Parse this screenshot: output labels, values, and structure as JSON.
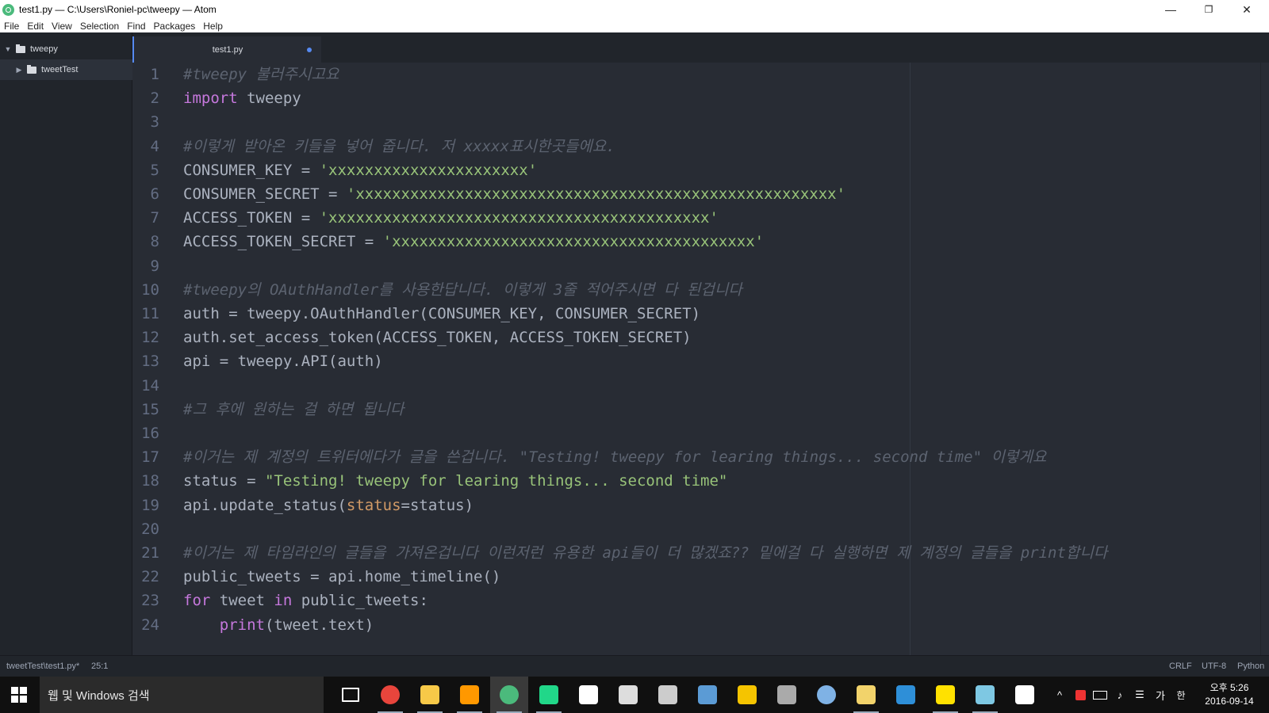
{
  "window": {
    "title": "test1.py — C:\\Users\\Roniel-pc\\tweepy — Atom",
    "controls": {
      "minimize": "—",
      "maximize": "❐",
      "close": "✕"
    }
  },
  "menu": [
    "File",
    "Edit",
    "View",
    "Selection",
    "Find",
    "Packages",
    "Help"
  ],
  "tree": {
    "root": "tweepy",
    "child": "tweetTest"
  },
  "tab": {
    "label": "test1.py"
  },
  "editor": {
    "lines": [
      {
        "n": "1",
        "parts": [
          {
            "c": "cm",
            "t": "#tweepy 불러주시고요"
          }
        ]
      },
      {
        "n": "2",
        "parts": [
          {
            "c": "kw",
            "t": "import"
          },
          {
            "c": "",
            "t": " tweepy"
          }
        ]
      },
      {
        "n": "3",
        "parts": []
      },
      {
        "n": "4",
        "parts": [
          {
            "c": "cm",
            "t": "#이렇게 받아온 키들을 넣어 줍니다. 저 xxxxx표시한곳들에요."
          }
        ]
      },
      {
        "n": "5",
        "parts": [
          {
            "c": "",
            "t": "CONSUMER_KEY = "
          },
          {
            "c": "st",
            "t": "'xxxxxxxxxxxxxxxxxxxxxx'"
          }
        ]
      },
      {
        "n": "6",
        "parts": [
          {
            "c": "",
            "t": "CONSUMER_SECRET = "
          },
          {
            "c": "st",
            "t": "'xxxxxxxxxxxxxxxxxxxxxxxxxxxxxxxxxxxxxxxxxxxxxxxxxxxxx'"
          }
        ]
      },
      {
        "n": "7",
        "parts": [
          {
            "c": "",
            "t": "ACCESS_TOKEN = "
          },
          {
            "c": "st",
            "t": "'xxxxxxxxxxxxxxxxxxxxxxxxxxxxxxxxxxxxxxxxxx'"
          }
        ]
      },
      {
        "n": "8",
        "parts": [
          {
            "c": "",
            "t": "ACCESS_TOKEN_SECRET = "
          },
          {
            "c": "st",
            "t": "'xxxxxxxxxxxxxxxxxxxxxxxxxxxxxxxxxxxxxxxx'"
          }
        ]
      },
      {
        "n": "9",
        "parts": []
      },
      {
        "n": "10",
        "parts": [
          {
            "c": "cm",
            "t": "#tweepy의 OAuthHandler를 사용한답니다. 이렇게 3줄 적어주시면 다 된겁니다"
          }
        ]
      },
      {
        "n": "11",
        "parts": [
          {
            "c": "",
            "t": "auth = tweepy.OAuthHandler(CONSUMER_KEY, CONSUMER_SECRET)"
          }
        ]
      },
      {
        "n": "12",
        "parts": [
          {
            "c": "",
            "t": "auth.set_access_token(ACCESS_TOKEN, ACCESS_TOKEN_SECRET)"
          }
        ]
      },
      {
        "n": "13",
        "parts": [
          {
            "c": "",
            "t": "api = tweepy.API(auth)"
          }
        ]
      },
      {
        "n": "14",
        "parts": []
      },
      {
        "n": "15",
        "parts": [
          {
            "c": "cm",
            "t": "#그 후에 원하는 걸 하면 됩니다"
          }
        ]
      },
      {
        "n": "16",
        "parts": []
      },
      {
        "n": "17",
        "parts": [
          {
            "c": "cm",
            "t": "#이거는 제 계정의 트위터에다가 글을 쓴겁니다. \"Testing! tweepy for learing things... second time\" 이렇게요"
          }
        ]
      },
      {
        "n": "18",
        "parts": [
          {
            "c": "",
            "t": "status = "
          },
          {
            "c": "st",
            "t": "\"Testing! tweepy for learing things... second time\""
          }
        ]
      },
      {
        "n": "19",
        "parts": [
          {
            "c": "",
            "t": "api.update_status("
          },
          {
            "c": "at",
            "t": "status"
          },
          {
            "c": "",
            "t": "=status)"
          }
        ]
      },
      {
        "n": "20",
        "parts": []
      },
      {
        "n": "21",
        "parts": [
          {
            "c": "cm",
            "t": "#이거는 제 타임라인의 글들을 가져온겁니다 이런저런 유용한 api들이 더 많겠죠?? 밑에걸 다 실행하면 제 계정의 글들을 print합니다"
          }
        ]
      },
      {
        "n": "22",
        "parts": [
          {
            "c": "",
            "t": "public_tweets = api.home_timeline()"
          }
        ]
      },
      {
        "n": "23",
        "parts": [
          {
            "c": "kw",
            "t": "for"
          },
          {
            "c": "",
            "t": " tweet "
          },
          {
            "c": "kw",
            "t": "in"
          },
          {
            "c": "",
            "t": " public_tweets:"
          }
        ]
      },
      {
        "n": "24",
        "parts": [
          {
            "c": "",
            "t": "    "
          },
          {
            "c": "kw",
            "t": "print"
          },
          {
            "c": "",
            "t": "(tweet.text)"
          }
        ]
      }
    ]
  },
  "status": {
    "file": "tweetTest\\test1.py*",
    "cursor": "25:1",
    "line_ending": "CRLF",
    "encoding": "UTF-8",
    "grammar": "Python"
  },
  "taskbar": {
    "search_placeholder": "웹 및 Windows 검색",
    "apps": [
      {
        "name": "task-view",
        "color": "#ffffff"
      },
      {
        "name": "chrome",
        "color": "#e8453c"
      },
      {
        "name": "file-explorer",
        "color": "#f7c948"
      },
      {
        "name": "sublime-text",
        "color": "#ff9800"
      },
      {
        "name": "atom",
        "color": "#4bba7c"
      },
      {
        "name": "pycharm",
        "color": "#21d789"
      },
      {
        "name": "unity",
        "color": "#ffffff"
      },
      {
        "name": "epic-games",
        "color": "#dddddd"
      },
      {
        "name": "terminal",
        "color": "#cccccc"
      },
      {
        "name": "network",
        "color": "#5b9bd5"
      },
      {
        "name": "lightbulb",
        "color": "#f5c400"
      },
      {
        "name": "game",
        "color": "#aaaaaa"
      },
      {
        "name": "globe",
        "color": "#7fb2e5"
      },
      {
        "name": "folder-sync",
        "color": "#f2d36b"
      },
      {
        "name": "outlook",
        "color": "#2e8fd8"
      },
      {
        "name": "kakaotalk",
        "color": "#ffe100"
      },
      {
        "name": "paint",
        "color": "#7ec8e3"
      },
      {
        "name": "photos",
        "color": "#ffffff"
      }
    ],
    "tray": {
      "ime": "가",
      "ime2": "한",
      "time": "오후 5:26",
      "date": "2016-09-14"
    }
  }
}
